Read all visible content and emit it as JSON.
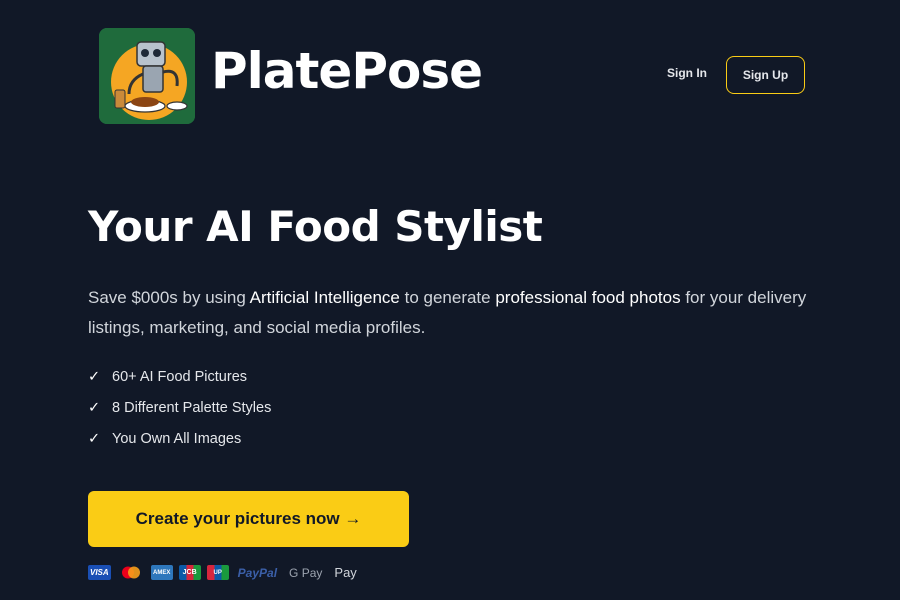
{
  "header": {
    "brand": "PlatePose",
    "logo_icon": "robot-chef-logo",
    "sign_in_label": "Sign In",
    "sign_up_label": "Sign Up"
  },
  "hero": {
    "headline": "Your AI Food Stylist",
    "description": {
      "part1": "Save $000s by using ",
      "hl1": "Artificial Intelligence",
      "part2": " to generate ",
      "hl2": "professional food photos",
      "part3": " for your delivery listings, marketing, and social media profiles."
    },
    "features": [
      {
        "check": "✓",
        "text": "60+ AI Food Pictures"
      },
      {
        "check": "✓",
        "text": "8 Different Palette Styles"
      },
      {
        "check": "✓",
        "text": "You Own All Images"
      }
    ],
    "cta_label": "Create your pictures now →"
  },
  "payments": {
    "visa": "VISA",
    "amex": "AMEX",
    "jcb": "JCB",
    "unionpay": "UP",
    "paypal": "PayPal",
    "gpay": "G Pay",
    "applepay": " Pay"
  },
  "colors": {
    "background": "#111827",
    "accent": "#facc15",
    "text": "#ffffff"
  }
}
